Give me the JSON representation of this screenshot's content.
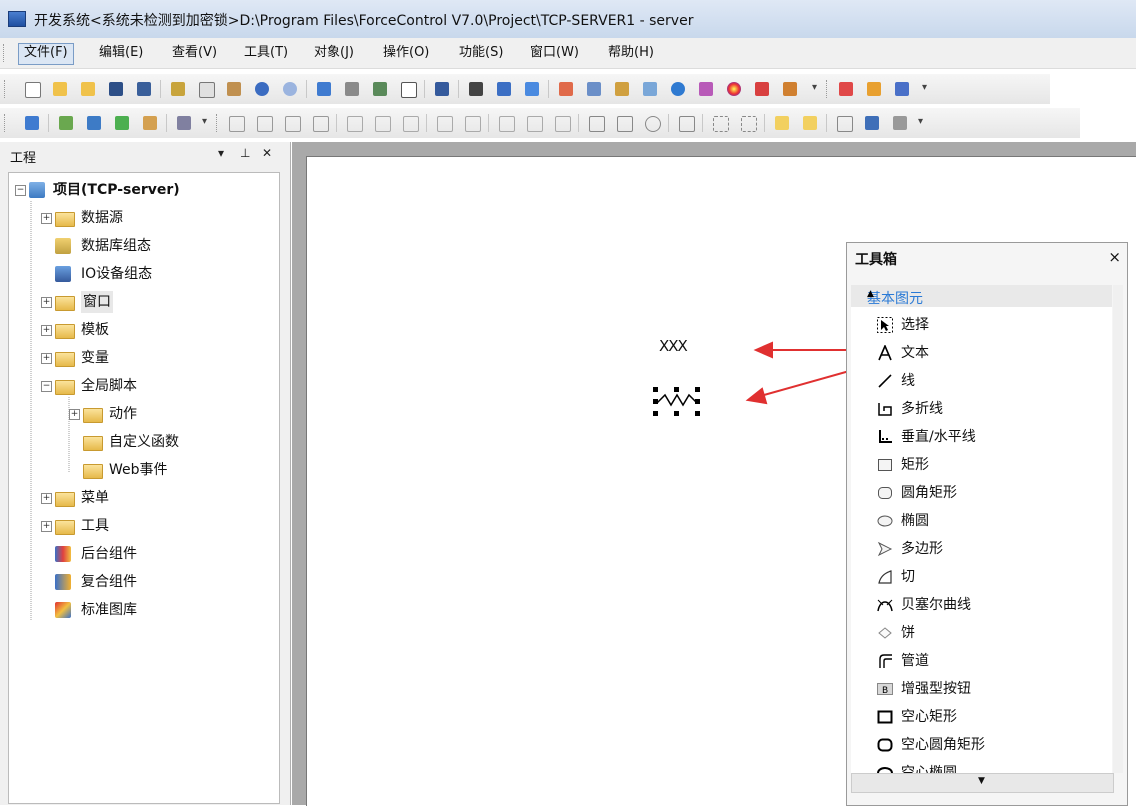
{
  "window": {
    "title": "开发系统<系统未检测到加密锁>D:\\Program Files\\ForceControl V7.0\\Project\\TCP-SERVER1 - server"
  },
  "menu": [
    {
      "label": "文件(F)",
      "active": true
    },
    {
      "label": "编辑(E)"
    },
    {
      "label": "查看(V)"
    },
    {
      "label": "工具(T)"
    },
    {
      "label": "对象(J)"
    },
    {
      "label": "操作(O)"
    },
    {
      "label": "功能(S)"
    },
    {
      "label": "窗口(W)"
    },
    {
      "label": "帮助(H)"
    }
  ],
  "project_panel": {
    "title": "工程",
    "dropdown_icon": "▾",
    "pin_icon": "⊥",
    "close_icon": "✕",
    "root": "项目(TCP-server)",
    "nodes": [
      {
        "label": "数据源"
      },
      {
        "label": "数据库组态"
      },
      {
        "label": "IO设备组态"
      },
      {
        "label": "窗口"
      },
      {
        "label": "模板"
      },
      {
        "label": "变量"
      },
      {
        "label": "全局脚本"
      },
      {
        "label": "动作"
      },
      {
        "label": "自定义函数"
      },
      {
        "label": "Web事件"
      },
      {
        "label": "菜单"
      },
      {
        "label": "工具"
      },
      {
        "label": "后台组件"
      },
      {
        "label": "复合组件"
      },
      {
        "label": "标准图库"
      }
    ]
  },
  "canvas": {
    "text_object": "XXX",
    "line_object_label": "selected-line"
  },
  "toolbox": {
    "title": "工具箱",
    "close": "×",
    "category": "基本图元",
    "tools": [
      {
        "label": "选择",
        "icon": "select-cursor-icon"
      },
      {
        "label": "文本",
        "icon": "text-a-icon"
      },
      {
        "label": "线",
        "icon": "line-icon"
      },
      {
        "label": "多折线",
        "icon": "polyline-icon"
      },
      {
        "label": "垂直/水平线",
        "icon": "vh-line-icon"
      },
      {
        "label": "矩形",
        "icon": "rectangle-icon"
      },
      {
        "label": "圆角矩形",
        "icon": "rounded-rect-icon"
      },
      {
        "label": "椭圆",
        "icon": "ellipse-icon"
      },
      {
        "label": "多边形",
        "icon": "polygon-icon"
      },
      {
        "label": "切",
        "icon": "chord-icon"
      },
      {
        "label": "贝塞尔曲线",
        "icon": "bezier-icon"
      },
      {
        "label": "饼",
        "icon": "pie-icon"
      },
      {
        "label": "管道",
        "icon": "pipe-icon"
      },
      {
        "label": "增强型按钮",
        "icon": "enhanced-button-icon"
      },
      {
        "label": "空心矩形",
        "icon": "hollow-rect-icon"
      },
      {
        "label": "空心圆角矩形",
        "icon": "hollow-rounded-rect-icon"
      },
      {
        "label": "空心椭圆",
        "icon": "hollow-ellipse-icon"
      }
    ]
  },
  "colors": {
    "accent": "#2a7ad6",
    "arrow": "#e03030",
    "folder": "#e6b94a"
  }
}
